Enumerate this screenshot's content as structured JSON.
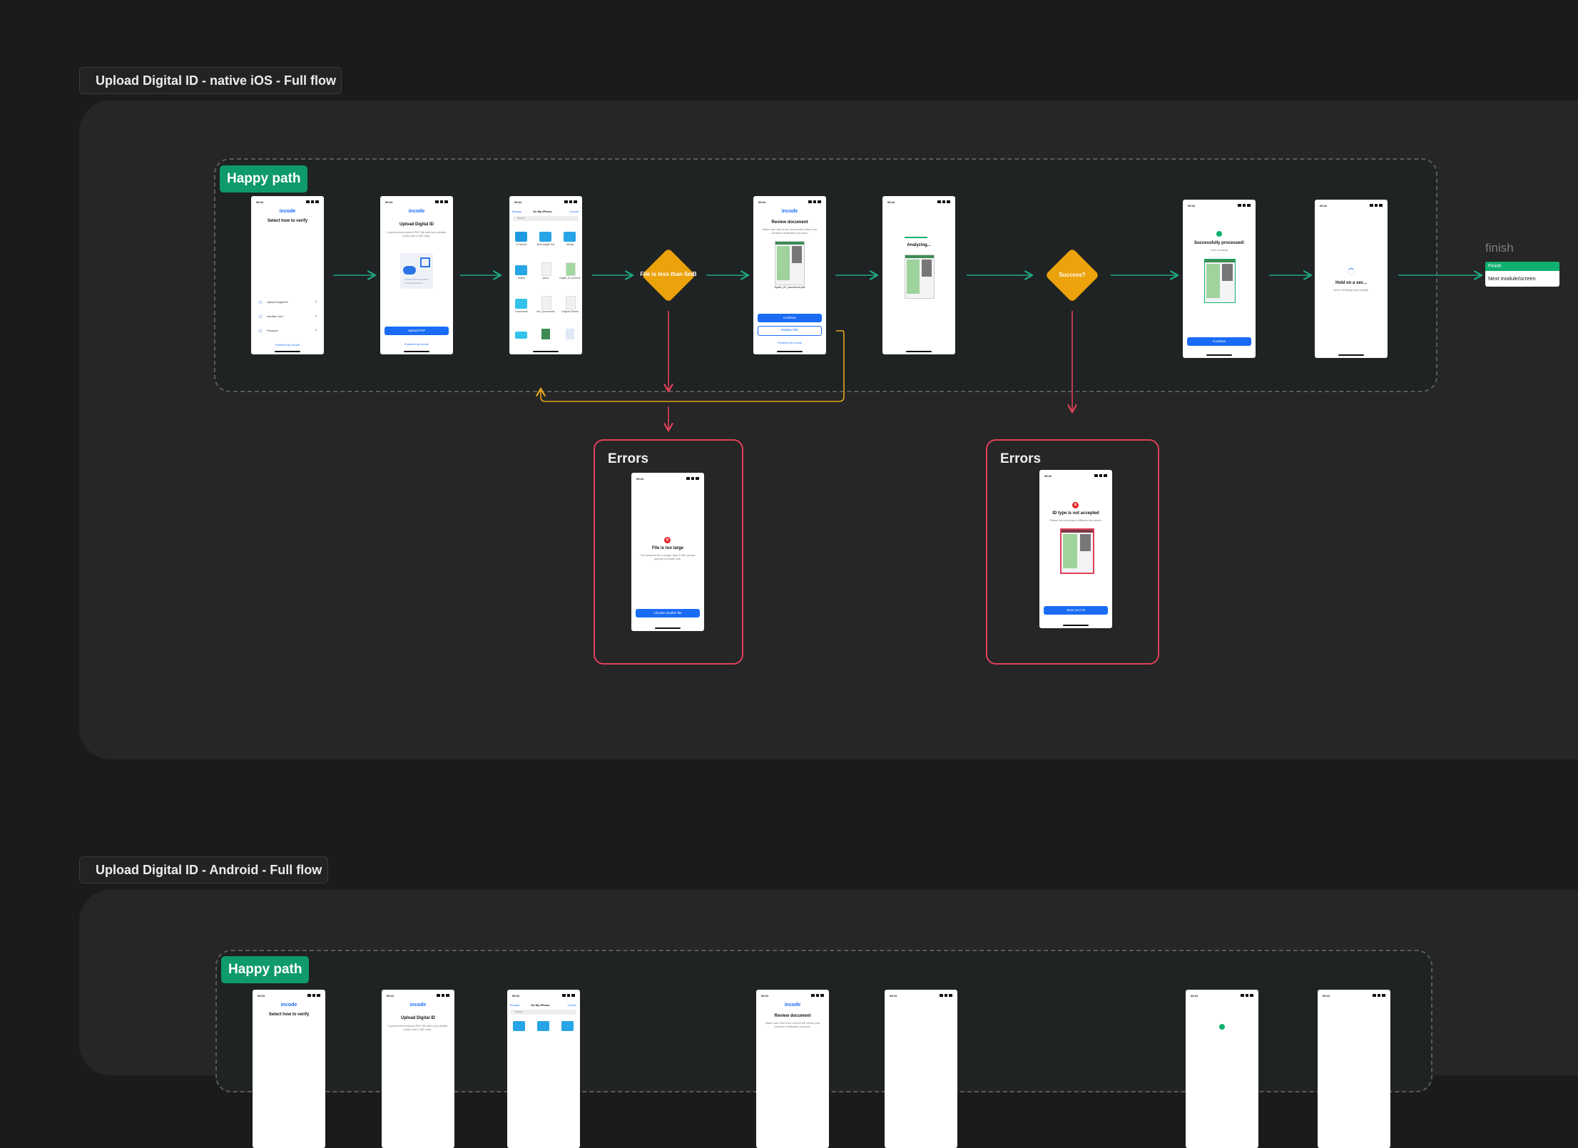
{
  "sections": [
    {
      "title": "Upload Digital ID - native iOS - Full flow"
    },
    {
      "title": "Upload Digital ID - Android - Full flow"
    }
  ],
  "lanes": {
    "happy_path": "Happy path",
    "errors": "Errors"
  },
  "colors": {
    "canvas": "#1b1b1b",
    "panel": "#262626",
    "lane_label": "#0e9a6c",
    "arrow_happy": "#1ea882",
    "arrow_error": "#e0405a",
    "arrow_loop": "#e3a51a",
    "decision": "#eba20b",
    "brand_blue": "#1a6cf5"
  },
  "decisions": {
    "size_check": "File is less than 5mB",
    "success": "Success?"
  },
  "finish": {
    "title": "finish",
    "header": "Finish",
    "item": "Next module/screen"
  },
  "brand": "incode",
  "screens": {
    "select": {
      "time": "09:41",
      "title": "Select how to verify",
      "options": [
        "Upload Digital ID",
        "Identity Card",
        "Passport"
      ],
      "footer": "Powered by incode"
    },
    "upload": {
      "time": "09:41",
      "title": "Upload Digital ID",
      "subtitle": "A government-issued PDF file with your details, photo and a QR code.",
      "button": "Upload PDF",
      "footer": "Powered by incode"
    },
    "picker": {
      "time": "09:41",
      "back": "Browse",
      "title": "On My iPhone",
      "cancel": "Cancel",
      "search": "Search",
      "files": [
        "Ai Stories",
        "Best Insight Pdf",
        "Affinity",
        "Notion",
        "(item)",
        "Digital_ID_scheme",
        "Downloads",
        "Info_Documents",
        "Original Sheets"
      ]
    },
    "review": {
      "time": "09:41",
      "title": "Review document",
      "subtitle": "Make sure this is the correct file before you continue verification process.",
      "filename": "Spain_ID_document.pdf",
      "continue": "Continue",
      "replace": "Replace file",
      "footer": "Powered by incode"
    },
    "analyzing": {
      "time": "09:41",
      "title": "Analyzing..."
    },
    "success": {
      "time": "09:41",
      "title": "Successfully processed!",
      "subtitle": "Let's continue",
      "button": "Continue"
    },
    "hold": {
      "time": "09:41",
      "title": "Hold on a sec...",
      "subtitle": "We're verifying your identity."
    },
    "too_large": {
      "time": "09:41",
      "title": "File is too large",
      "subtitle": "The selected file is larger than 5 MB, please upload a smaller one.",
      "button": "Choose another file"
    },
    "not_accepted": {
      "time": "09:41",
      "title": "ID type is not accepted",
      "subtitle": "Please try scanning a different document.",
      "button": "Scan your ID"
    }
  },
  "android_screens": {
    "select": {
      "time": "09:41",
      "title": "Select how to verify"
    },
    "upload": {
      "time": "09:41",
      "title": "Upload Digital ID",
      "subtitle": "A government-issued PDF file with your details, photo and a QR code."
    },
    "picker": {
      "time": "09:41",
      "back": "Browse",
      "title": "On My iPhone",
      "cancel": "Cancel",
      "search": "Search"
    },
    "review": {
      "time": "09:41",
      "title": "Review document",
      "subtitle": "Make sure this is the correct file before you continue verification process."
    },
    "analyzing": {
      "time": "09:41"
    },
    "success": {
      "time": "09:41"
    },
    "hold": {
      "time": "09:41"
    }
  }
}
